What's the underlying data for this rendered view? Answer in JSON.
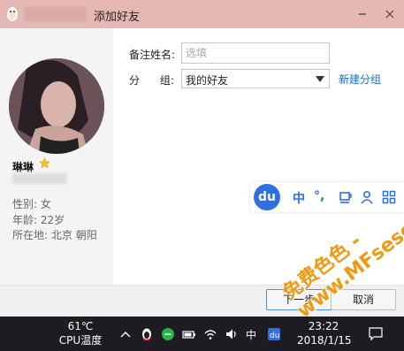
{
  "dialog": {
    "title": "添加好友"
  },
  "profile": {
    "nickname": "琳琳",
    "gender_label": "性别:",
    "gender": "女",
    "age_label": "年龄:",
    "age": "22岁",
    "location_label": "所在地:",
    "location": "北京  朝阳"
  },
  "form": {
    "remark_label": "备注姓名:",
    "remark_placeholder": "选填",
    "group_label": "分      组:",
    "group_value": "我的好友",
    "new_group_link": "新建分组"
  },
  "ime": {
    "logo": "du",
    "mode": "中",
    "punct": "°,"
  },
  "buttons": {
    "next": "下一步",
    "cancel": "取消"
  },
  "watermark": {
    "line1": "免费色色 -",
    "line2": "www.MFsese.com"
  },
  "taskbar": {
    "temp_value": "61℃",
    "temp_label": "CPU温度",
    "ime_indicator": "中",
    "time": "23:22",
    "date": "2018/1/15"
  },
  "colors": {
    "titlebar": "#e6b8b4",
    "link": "#1a6fc0",
    "ime_accent": "#2f6fe0",
    "taskbar": "#1c1c22",
    "watermark": "#f09a14"
  }
}
